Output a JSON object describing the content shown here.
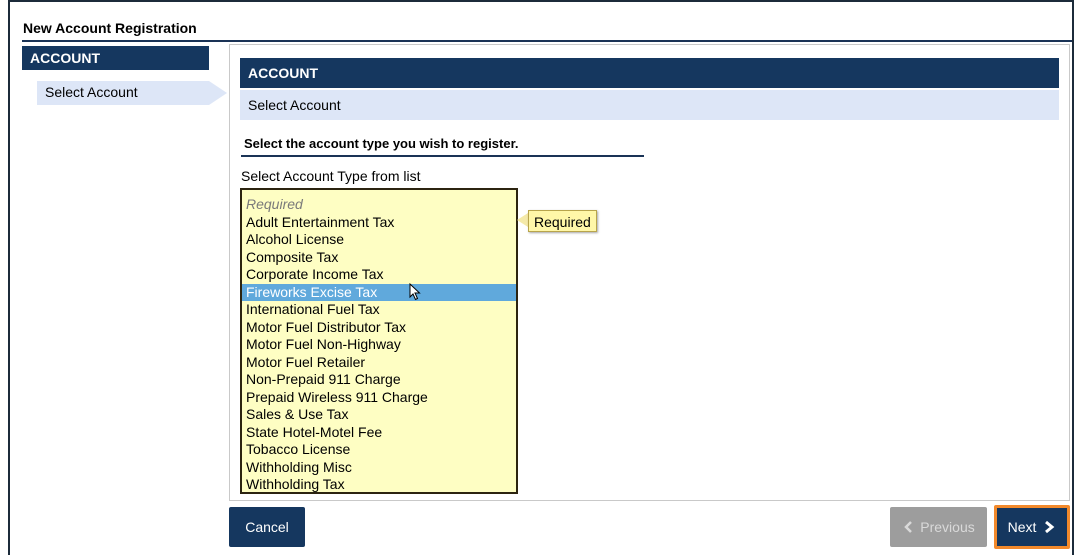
{
  "page": {
    "title": "New Account Registration"
  },
  "sidebar": {
    "header": "ACCOUNT",
    "items": [
      {
        "label": "Select Account",
        "active": true
      }
    ]
  },
  "section": {
    "header": "ACCOUNT",
    "subheader": "Select Account",
    "instruction": "Select the account type you wish to register.",
    "field_label": "Select Account Type from list"
  },
  "account_types": {
    "placeholder": "Required",
    "selected": "Fireworks Excise Tax",
    "options": [
      "Adult Entertainment Tax",
      "Alcohol License",
      "Composite Tax",
      "Corporate Income Tax",
      "Fireworks Excise Tax",
      "International Fuel Tax",
      "Motor Fuel Distributor Tax",
      "Motor Fuel Non-Highway",
      "Motor Fuel Retailer",
      "Non-Prepaid 911 Charge",
      "Prepaid Wireless 911 Charge",
      "Sales & Use Tax",
      "State Hotel-Motel Fee",
      "Tobacco License",
      "Withholding Misc",
      "Withholding Tax"
    ]
  },
  "tooltip": {
    "text": "Required"
  },
  "buttons": {
    "cancel": "Cancel",
    "previous": "Previous",
    "next": "Next"
  },
  "icons": {
    "previous": "chevron-left-icon",
    "next": "chevron-right-icon",
    "cursor": "mouse-pointer-icon"
  },
  "colors": {
    "navy": "#15375f",
    "light_blue": "#dde6f7",
    "list_bg": "#fefec3",
    "selected": "#60a9dc",
    "accent_orange": "#f2892b"
  }
}
